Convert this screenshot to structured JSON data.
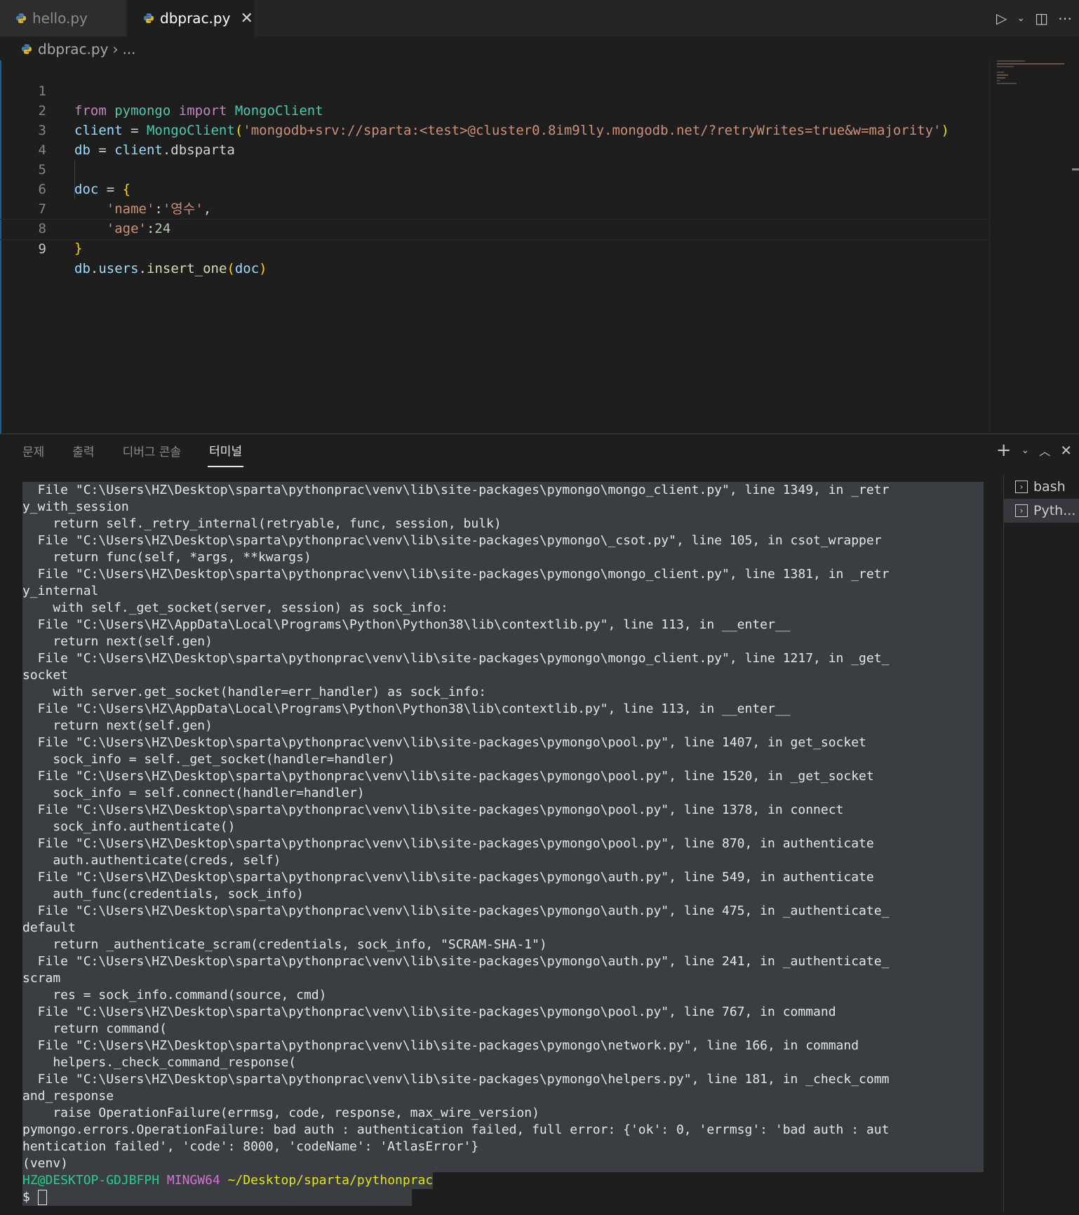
{
  "tabs": [
    {
      "label": "hello.py",
      "active": false
    },
    {
      "label": "dbprac.py",
      "active": true
    }
  ],
  "breadcrumb": {
    "file": "dbprac.py",
    "rest": "..."
  },
  "editor": {
    "lines": [
      {
        "n": "1"
      },
      {
        "n": "2"
      },
      {
        "n": "3"
      },
      {
        "n": "4"
      },
      {
        "n": "5"
      },
      {
        "n": "6"
      },
      {
        "n": "7"
      },
      {
        "n": "8"
      },
      {
        "n": "9"
      }
    ],
    "code": {
      "l1_from": "from",
      "l1_mod": "pymongo",
      "l1_import": "import",
      "l1_cls": "MongoClient",
      "l2_var": "client",
      "l2_eq": " = ",
      "l2_cls": "MongoClient",
      "l2_open": "(",
      "l2_str": "'mongodb+srv://sparta:<test>@cluster0.8im9lly.mongodb.net/?retryWrites=true&w=majority'",
      "l2_close": ")",
      "l3_var": "db",
      "l3_eq": " = ",
      "l3_client": "client",
      "l3_attr": ".dbsparta",
      "l5_var": "doc",
      "l5_eq": " = ",
      "l5_brace": "{",
      "l6_key": "'name'",
      "l6_colon": ":",
      "l6_val": "'영수'",
      "l6_comma": ",",
      "l7_key": "'age'",
      "l7_colon": ":",
      "l7_val": "24",
      "l8_brace": "}",
      "l9_db": "db",
      "l9_dot": ".",
      "l9_users": "users",
      "l9_dot2": ".",
      "l9_fn": "insert_one",
      "l9_open": "(",
      "l9_arg": "doc",
      "l9_close": ")"
    }
  },
  "panel": {
    "tabs": [
      "문제",
      "출력",
      "디버그 콘솔",
      "터미널"
    ],
    "active_tab": "터미널",
    "terminals": [
      "bash",
      "Pyth..."
    ]
  },
  "terminal": {
    "lines": [
      "  File \"C:\\Users\\HZ\\Desktop\\sparta\\pythonprac\\venv\\lib\\site-packages\\pymongo\\mongo_client.py\", line 1349, in _retr",
      "y_with_session",
      "    return self._retry_internal(retryable, func, session, bulk)",
      "  File \"C:\\Users\\HZ\\Desktop\\sparta\\pythonprac\\venv\\lib\\site-packages\\pymongo\\_csot.py\", line 105, in csot_wrapper",
      "    return func(self, *args, **kwargs)",
      "  File \"C:\\Users\\HZ\\Desktop\\sparta\\pythonprac\\venv\\lib\\site-packages\\pymongo\\mongo_client.py\", line 1381, in _retr",
      "y_internal",
      "    with self._get_socket(server, session) as sock_info:",
      "  File \"C:\\Users\\HZ\\AppData\\Local\\Programs\\Python\\Python38\\lib\\contextlib.py\", line 113, in __enter__",
      "    return next(self.gen)",
      "  File \"C:\\Users\\HZ\\Desktop\\sparta\\pythonprac\\venv\\lib\\site-packages\\pymongo\\mongo_client.py\", line 1217, in _get_",
      "socket",
      "    with server.get_socket(handler=err_handler) as sock_info:",
      "  File \"C:\\Users\\HZ\\AppData\\Local\\Programs\\Python\\Python38\\lib\\contextlib.py\", line 113, in __enter__",
      "    return next(self.gen)",
      "  File \"C:\\Users\\HZ\\Desktop\\sparta\\pythonprac\\venv\\lib\\site-packages\\pymongo\\pool.py\", line 1407, in get_socket",
      "    sock_info = self._get_socket(handler=handler)",
      "  File \"C:\\Users\\HZ\\Desktop\\sparta\\pythonprac\\venv\\lib\\site-packages\\pymongo\\pool.py\", line 1520, in _get_socket",
      "    sock_info = self.connect(handler=handler)",
      "  File \"C:\\Users\\HZ\\Desktop\\sparta\\pythonprac\\venv\\lib\\site-packages\\pymongo\\pool.py\", line 1378, in connect",
      "    sock_info.authenticate()",
      "  File \"C:\\Users\\HZ\\Desktop\\sparta\\pythonprac\\venv\\lib\\site-packages\\pymongo\\pool.py\", line 870, in authenticate",
      "    auth.authenticate(creds, self)",
      "  File \"C:\\Users\\HZ\\Desktop\\sparta\\pythonprac\\venv\\lib\\site-packages\\pymongo\\auth.py\", line 549, in authenticate",
      "    auth_func(credentials, sock_info)",
      "  File \"C:\\Users\\HZ\\Desktop\\sparta\\pythonprac\\venv\\lib\\site-packages\\pymongo\\auth.py\", line 475, in _authenticate_",
      "default",
      "    return _authenticate_scram(credentials, sock_info, \"SCRAM-SHA-1\")",
      "  File \"C:\\Users\\HZ\\Desktop\\sparta\\pythonprac\\venv\\lib\\site-packages\\pymongo\\auth.py\", line 241, in _authenticate_",
      "scram",
      "    res = sock_info.command(source, cmd)",
      "  File \"C:\\Users\\HZ\\Desktop\\sparta\\pythonprac\\venv\\lib\\site-packages\\pymongo\\pool.py\", line 767, in command",
      "    return command(",
      "  File \"C:\\Users\\HZ\\Desktop\\sparta\\pythonprac\\venv\\lib\\site-packages\\pymongo\\network.py\", line 166, in command",
      "    helpers._check_command_response(",
      "  File \"C:\\Users\\HZ\\Desktop\\sparta\\pythonprac\\venv\\lib\\site-packages\\pymongo\\helpers.py\", line 181, in _check_comm",
      "and_response",
      "    raise OperationFailure(errmsg, code, response, max_wire_version)",
      "pymongo.errors.OperationFailure: bad auth : authentication failed, full error: {'ok': 0, 'errmsg': 'bad auth : aut",
      "hentication failed', 'code': 8000, 'codeName': 'AtlasError'}",
      "(venv)"
    ],
    "prompt_user": "HZ@DESKTOP-GDJBFPH",
    "prompt_env": "MINGW64",
    "prompt_path": "~/Desktop/sparta/pythonprac",
    "prompt_symbol": "$ "
  },
  "colors": {
    "accent": "#0e639c",
    "prompt_user": "#23d18b",
    "prompt_env": "#d670d6",
    "prompt_path": "#e5e510"
  },
  "icons": {
    "file": "python-icon",
    "run": "play-icon",
    "split": "split-editor-icon",
    "more": "more-icon",
    "add": "plus-icon",
    "maximize": "chevron-up-icon",
    "close": "close-icon",
    "terminal": "terminal-icon"
  }
}
